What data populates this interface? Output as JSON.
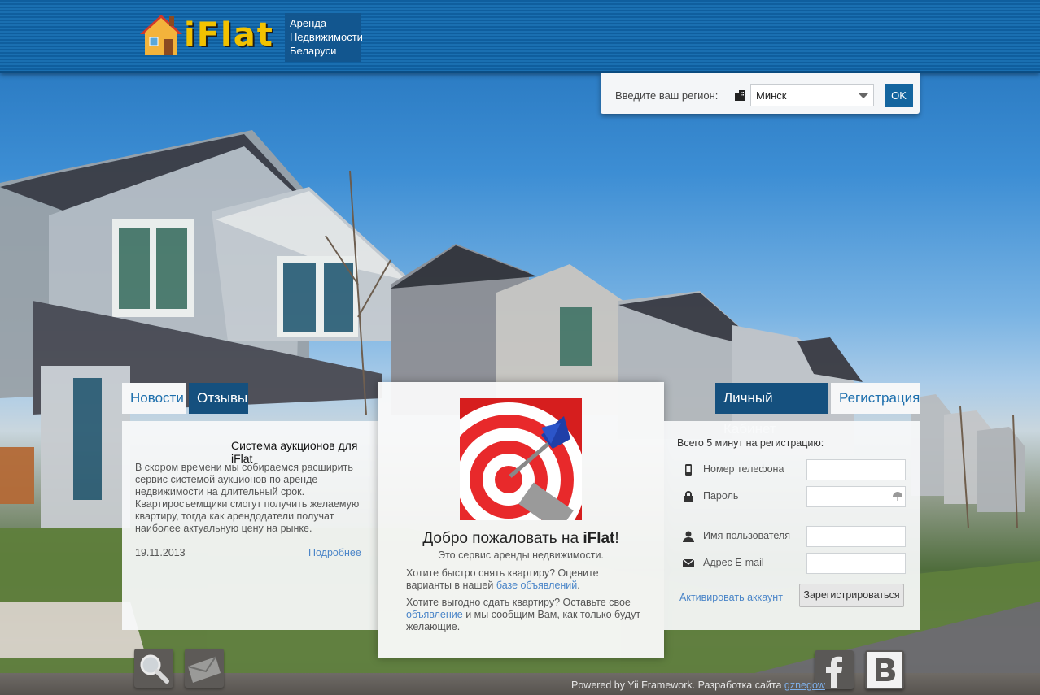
{
  "header": {
    "logo_text": "iFlat",
    "tagline_lines": [
      "Аренда",
      "Недвижимости",
      "Беларуси"
    ]
  },
  "region": {
    "label": "Введите ваш регион:",
    "selected": "Минск",
    "ok_label": "OK"
  },
  "news_panel": {
    "tabs": [
      {
        "label": "Новости",
        "active": true
      },
      {
        "label": "Отзывы",
        "active": false
      }
    ],
    "title": "Система аукционов для iFlat",
    "body": "В скором времени мы собираемся расширить сервис системой аукционов по аренде недвижимости на длительный срок. Квартиросъемщики смогут получить желаемую квартиру, тогда как арендодатели получат наиболее актуальную цену на рынке.",
    "date": "19.11.2013",
    "more_link": "Подробнее"
  },
  "welcome": {
    "title_prefix": "Добро пожаловать на ",
    "title_brand": "iFlat",
    "title_suffix": "!",
    "subtitle": "Это сервис аренды недвижимости.",
    "p1_text": "Хотите быстро снять квартиру? Оцените варианты в нашей ",
    "p1_link": "базе объявлений",
    "p1_end": ".",
    "p2_text": "Хотите выгодно сдать квартиру? Оставьте свое ",
    "p2_link": "объявление",
    "p2_end": " и мы сообщим Вам, как только будут желающие."
  },
  "account_panel": {
    "tabs": [
      {
        "label": "Личный Кабинет",
        "active": false
      },
      {
        "label": "Регистрация",
        "active": true
      }
    ],
    "intro": "Всего 5 минут на регистрацию:",
    "fields": {
      "phone": "Номер телефона",
      "password": "Пароль",
      "username": "Имя пользователя",
      "email": "Адрес E-mail"
    },
    "activate_link": "Активировать аккаунт",
    "register_button": "Зарегистрироваться"
  },
  "footer": {
    "text": "Powered by Yii Framework. Разработка сайта ",
    "author_link": "gznegow"
  },
  "colors": {
    "header_blue": "#1a6fb1",
    "tab_dark": "#15507e",
    "link": "#4a85c8"
  },
  "icons": [
    "search-icon",
    "mail-icon",
    "facebook-icon",
    "vk-icon",
    "building-icon",
    "phone-icon",
    "lock-icon",
    "user-icon",
    "envelope-icon",
    "umbrella-icon"
  ]
}
